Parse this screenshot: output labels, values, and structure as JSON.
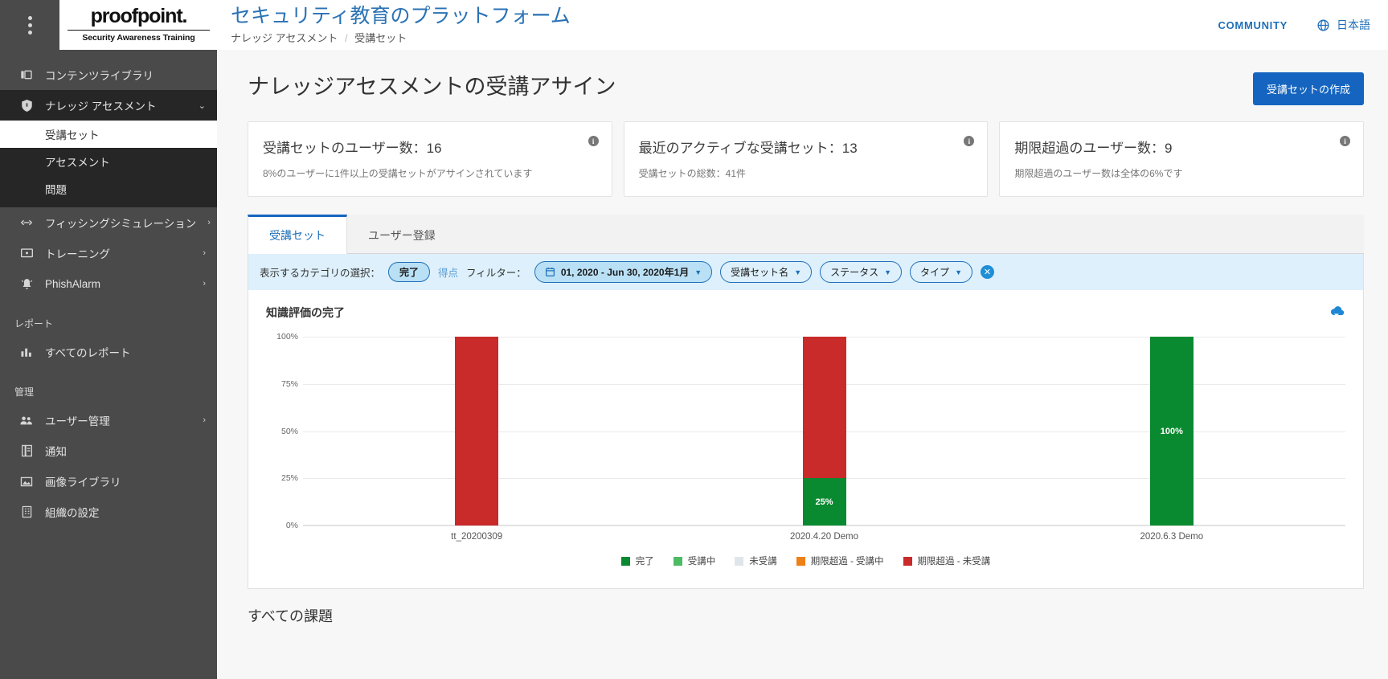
{
  "topbar": {
    "kebab_icon": "kebab-menu-icon",
    "logo_word": "proofpoint.",
    "logo_sub": "Security Awareness Training",
    "app_title": "セキュリティ教育のプラットフォーム",
    "breadcrumb": [
      "ナレッジ アセスメント",
      "受講セット"
    ],
    "breadcrumb_sep": "/",
    "community_label": "COMMUNITY",
    "language_label": "日本語",
    "globe_icon": "globe-icon"
  },
  "sidebar": {
    "items": [
      {
        "label": "コンテンツライブラリ",
        "icon": "library-icon",
        "chevron": "",
        "state": "normal"
      },
      {
        "label": "ナレッジ アセスメント",
        "icon": "shield-icon",
        "chevron": "⌄",
        "state": "active"
      },
      {
        "label": "フィッシングシミュレーション",
        "icon": "link-icon",
        "chevron": "›",
        "state": "normal"
      },
      {
        "label": "トレーニング",
        "icon": "monitor-icon",
        "chevron": "›",
        "state": "normal"
      },
      {
        "label": "PhishAlarm",
        "icon": "alarm-icon",
        "chevron": "›",
        "state": "normal"
      }
    ],
    "subitems": [
      {
        "label": "受講セット",
        "state": "current"
      },
      {
        "label": "アセスメント",
        "state": "normal"
      },
      {
        "label": "問題",
        "state": "normal"
      }
    ],
    "section_reports": "レポート",
    "reports_items": [
      {
        "label": "すべてのレポート",
        "icon": "bar-chart-icon"
      }
    ],
    "section_admin": "管理",
    "admin_items": [
      {
        "label": "ユーザー管理",
        "icon": "users-icon",
        "chevron": "›"
      },
      {
        "label": "通知",
        "icon": "document-icon",
        "chevron": ""
      },
      {
        "label": "画像ライブラリ",
        "icon": "image-icon",
        "chevron": ""
      },
      {
        "label": "組織の設定",
        "icon": "building-icon",
        "chevron": ""
      }
    ]
  },
  "page": {
    "title": "ナレッジアセスメントの受講アサイン",
    "create_button": "受講セットの作成"
  },
  "cards": [
    {
      "title": "受講セットのユーザー数：16",
      "sub": "8%のユーザーに1件以上の受講セットがアサインされています",
      "info": "i"
    },
    {
      "title": "最近のアクティブな受講セット：13",
      "sub": "受講セットの総数：41件",
      "info": "i"
    },
    {
      "title": "期限超過のユーザー数：9",
      "sub": "期限超過のユーザー数は全体の6%です",
      "info": "i"
    }
  ],
  "tabs": [
    {
      "label": "受講セット",
      "active": true
    },
    {
      "label": "ユーザー登録",
      "active": false
    }
  ],
  "filterbar": {
    "category_label": "表示するカテゴリの選択：",
    "category_selected": "完了",
    "category_other": "得点",
    "filter_label": "フィルター：",
    "date_pill": "01, 2020 - Jun 30, 2020年1月",
    "calendar_icon": "calendar-icon",
    "pills": [
      "受講セット名",
      "ステータス",
      "タイプ"
    ],
    "clear_icon": "clear-filters-icon"
  },
  "chart_data": {
    "type": "bar",
    "title": "知識評価の完了",
    "stacked": true,
    "categories": [
      "tt_20200309",
      "2020.4.20 Demo",
      "2020.6.3 Demo"
    ],
    "xlabel": "",
    "ylabel": "",
    "ylim": [
      0,
      100
    ],
    "yticks": [
      "0%",
      "25%",
      "50%",
      "75%",
      "100%"
    ],
    "grid": true,
    "legend_position": "bottom",
    "series": [
      {
        "name": "完了",
        "color": "#0a8a30",
        "values": [
          0,
          25,
          100
        ],
        "labels": [
          "",
          "25%",
          "100%"
        ]
      },
      {
        "name": "受講中",
        "color": "#4cbb63",
        "values": [
          0,
          0,
          0
        ],
        "labels": [
          "",
          "",
          ""
        ]
      },
      {
        "name": "未受講",
        "color": "#dfe6e9",
        "values": [
          0,
          0,
          0
        ],
        "labels": [
          "",
          "",
          ""
        ]
      },
      {
        "name": "期限超過 - 受講中",
        "color": "#ef7f17",
        "values": [
          0,
          0,
          0
        ],
        "labels": [
          "",
          "",
          ""
        ]
      },
      {
        "name": "期限超過 - 未受講",
        "color": "#c92a2a",
        "values": [
          100,
          75,
          0
        ],
        "labels": [
          "",
          "",
          ""
        ]
      }
    ],
    "download_icon": "download-cloud-icon"
  },
  "footer_section": {
    "title": "すべての課題"
  }
}
